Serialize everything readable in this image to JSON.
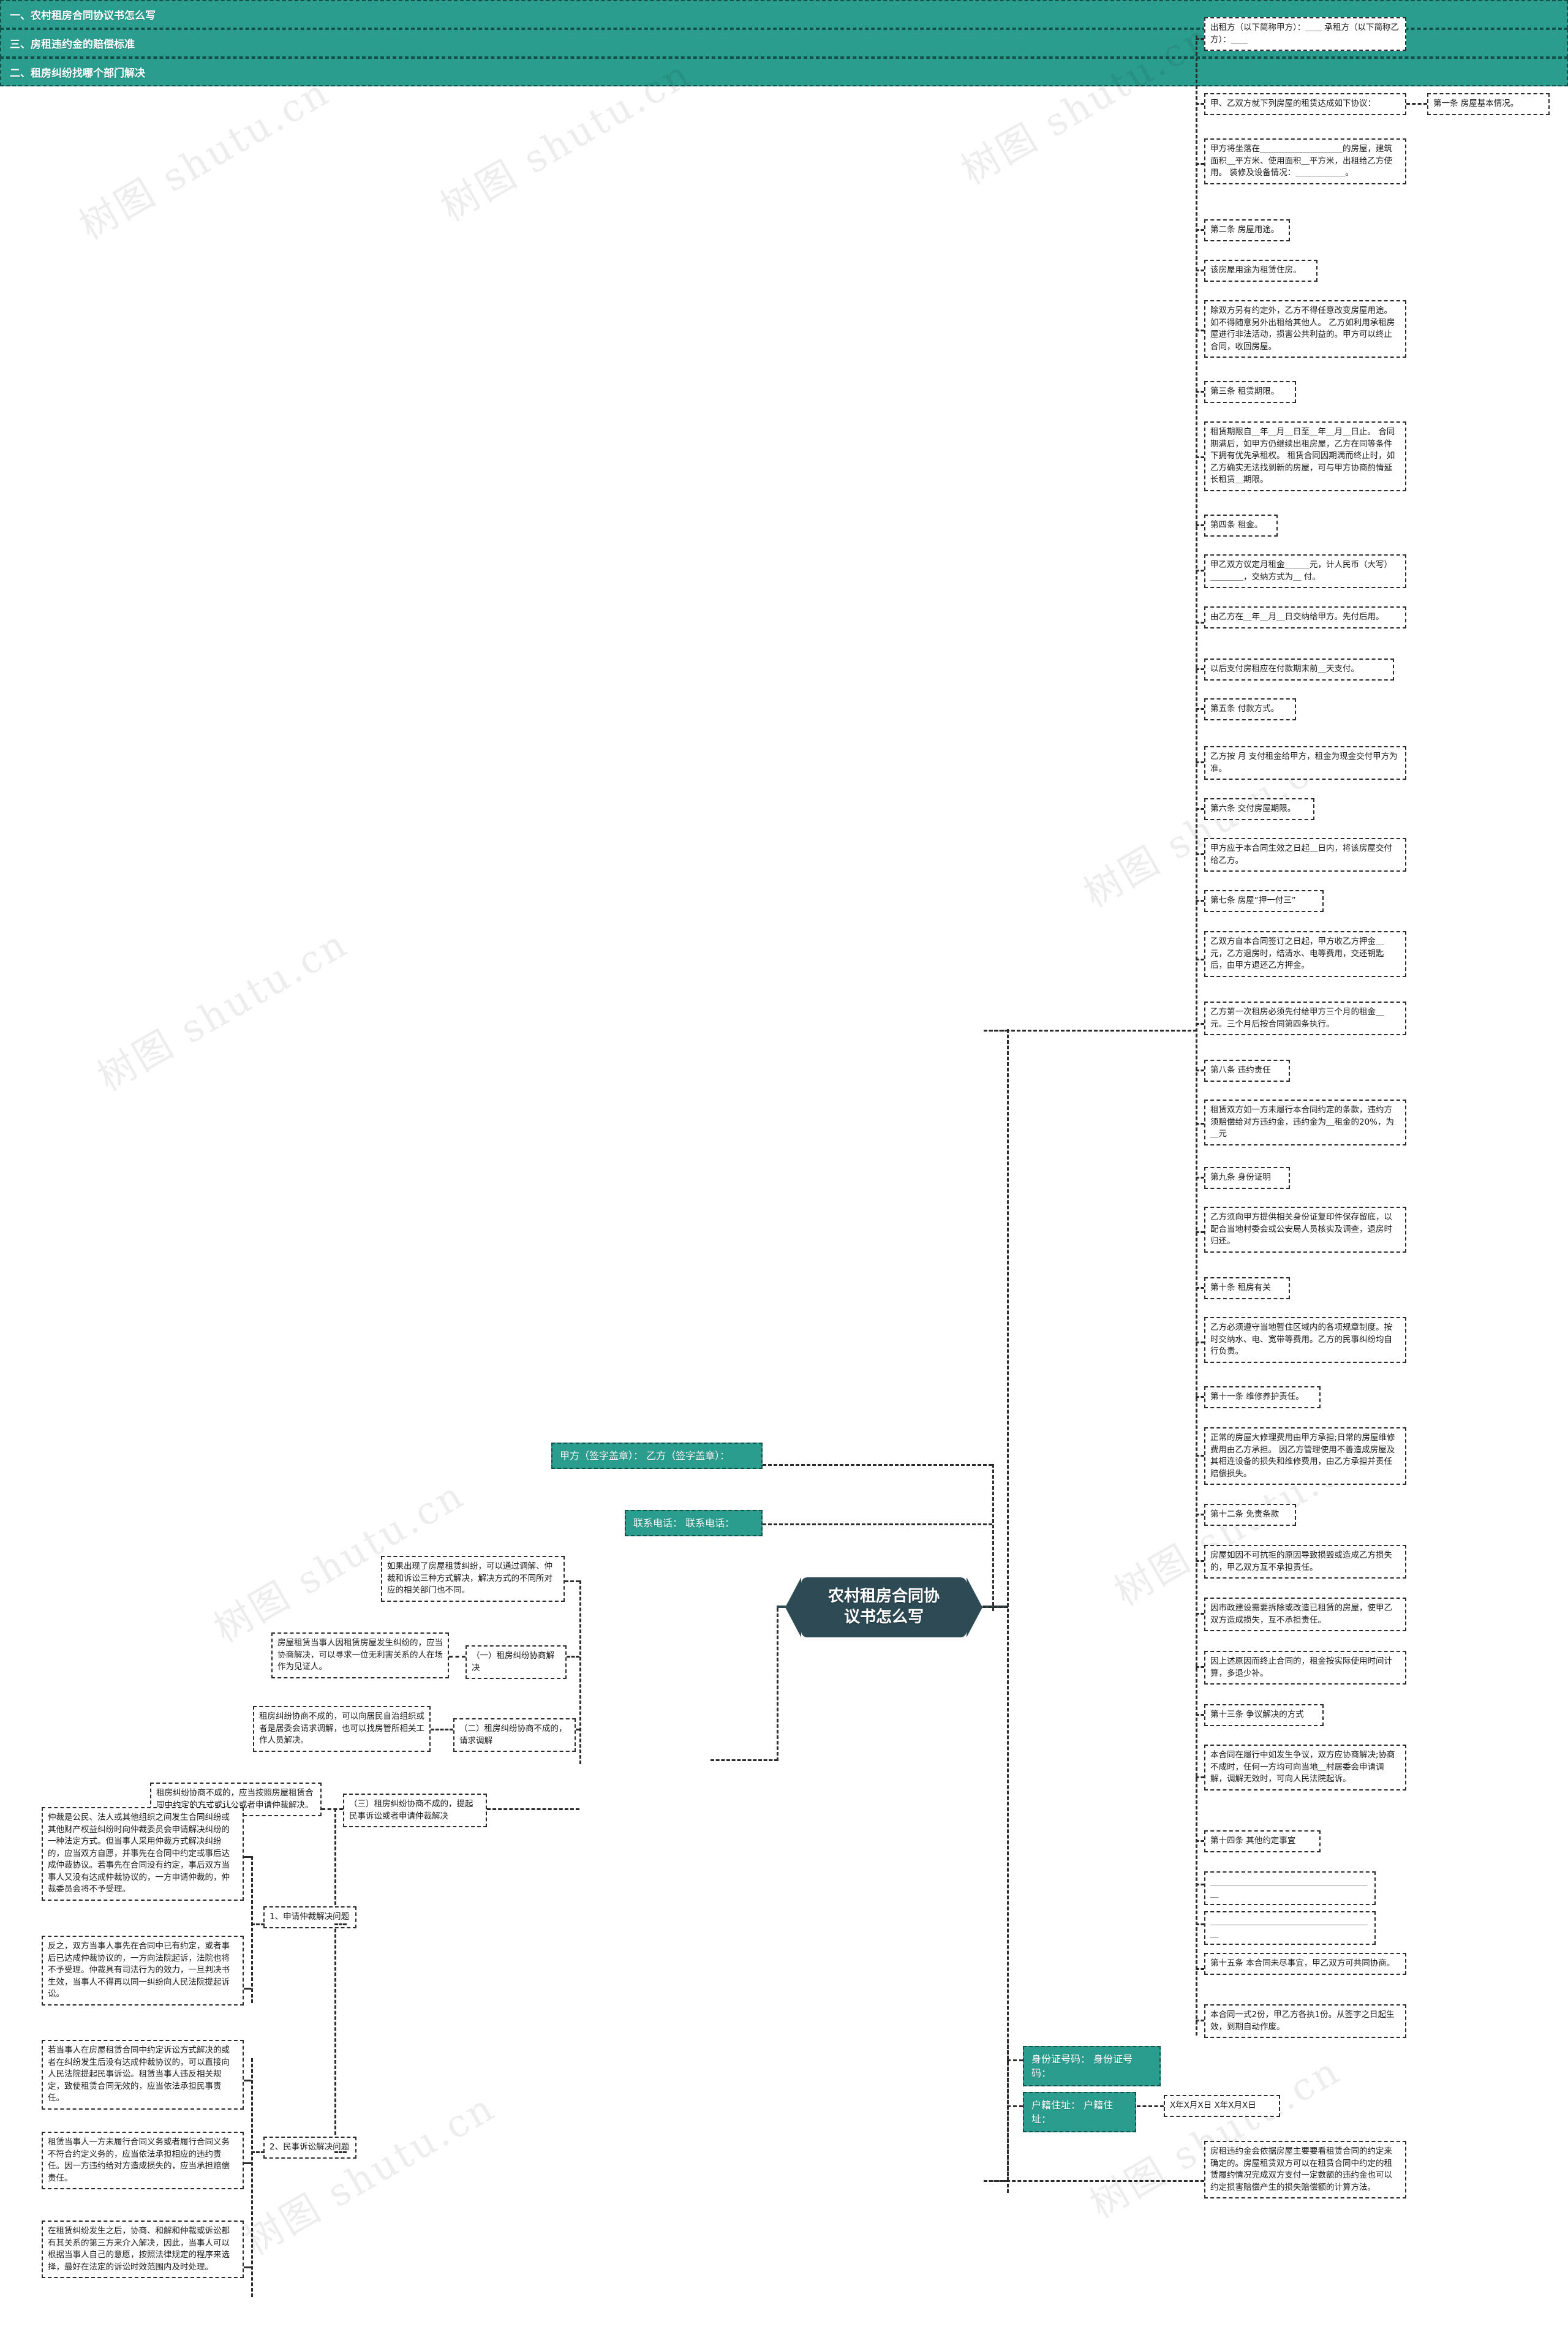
{
  "root": {
    "title": "农村租房合同协议书怎么写"
  },
  "watermarks": [
    "树图 shutu.cn",
    "树图 shutu.cn",
    "树图 shutu.cn",
    "树图 shutu.cn",
    "树图 shutu.cn",
    "树图 shutu.cn",
    "树图 shutu.cn",
    "树图 shutu.cn",
    "树图 shutu.cn"
  ],
  "branches": [
    {
      "id": "b1",
      "label": "一、农村租房合同协议书怎么写"
    },
    {
      "id": "b2",
      "label": "二、租房纠纷找哪个部门解决"
    },
    {
      "id": "b3",
      "label": "三、房租违约金的赔偿标准"
    }
  ],
  "branch1_nodes": [
    "出租方（以下简称甲方）：＿＿ 承租方（以下简称乙方）：＿＿",
    "甲、乙双方就下列房屋的租赁达成如下协议：",
    "第一条 房屋基本情况。",
    "甲方将坐落在＿＿＿＿＿＿＿＿＿＿的房屋，建筑面积＿平方米、使用面积＿平方米，出租给乙方使用。 装修及设备情况：＿＿＿＿＿＿。",
    "第二条 房屋用途。",
    "该房屋用途为租赁住房。",
    "除双方另有约定外，乙方不得任意改变房屋用途。如不得随意另外出租给其他人。 乙方如利用承租房屋进行非法活动，损害公共利益的。甲方可以终止合同，收回房屋。",
    "第三条 租赁期限。",
    "租赁期限自＿年＿月＿日至＿年＿月＿日止。 合同期满后，如甲方仍继续出租房屋，乙方在同等条件下拥有优先承租权。 租赁合同因期满而终止时，如乙方确实无法找到新的房屋，可与甲方协商酌情延长租赁＿期限。",
    "第四条 租金。",
    "甲乙双方议定月租金＿＿＿元，计人民币（大写）＿＿＿＿，交纳方式为＿ 付。",
    "由乙方在＿年＿月＿日交纳给甲方。先付后用。",
    "以后支付房租应在付款期末前＿天支付。",
    "第五条 付款方式。",
    "乙方按 月 支付租金给甲方，租金为现金交付甲方为准。",
    "第六条 交付房屋期限。",
    "甲方应于本合同生效之日起＿日内，将该房屋交付给乙方。",
    "第七条 房屋“押一付三”",
    "乙双方自本合同签订之日起，甲方收乙方押金＿元，乙方退房时，结清水、电等费用，交还钥匙后，由甲方退还乙方押金。",
    "乙方第一次租房必须先付给甲方三个月的租金＿元。三个月后按合同第四条执行。",
    "第八条 违约责任",
    "租赁双方如一方未履行本合同约定的条款，违约方须赔偿给对方违约金，违约金为＿租金的20%，为＿元",
    "第九条 身份证明",
    "乙方须向甲方提供相关身份证复印件保存留底，以配合当地村委会或公安局人员核实及调查，退房时归还。",
    "第十条 租房有关",
    "乙方必须遵守当地暂住区域内的各项规章制度。按时交纳水、电、宽带等费用。乙方的民事纠纷均自行负责。",
    "第十一条 维修养护责任。",
    "正常的房屋大修理费用由甲方承担;日常的房屋维修费用由乙方承担。 因乙方管理使用不善造成房屋及其相连设备的损失和维修费用，由乙方承担并责任赔偿损失。",
    "第十二条 免责条款",
    "房屋如因不可抗拒的原因导致损毁或造成乙方损失的，甲乙双方互不承担责任。",
    "因市政建设需要拆除或改造已租赁的房屋，使甲乙双方造成损失，互不承担责任。",
    "因上述原因而终止合同的，租金按实际使用时间计算，多退少补。",
    "第十三条 争议解决的方式",
    "本合同在履行中如发生争议，双方应协商解决;协商不成时，任何一方均可向当地＿村居委会申请调解，调解无效时，可向人民法院起诉。",
    "第十四条 其他约定事宜",
    "＿＿＿＿＿＿＿＿＿＿＿＿＿＿＿＿＿＿＿＿",
    "＿＿＿＿＿＿＿＿＿＿＿＿＿＿＿＿＿＿＿＿",
    "第十五条 本合同未尽事宜，甲乙双方可共同协商。",
    "本合同一式2份，甲乙方各执1份。从签字之日起生效，到期自动作废。"
  ],
  "signature_nodes": [
    "甲方（签字盖章）： 乙方（签字盖章）：",
    "联系电话： 联系电话："
  ],
  "footer_nodes": [
    "身份证号码： 身份证号码：",
    "户籍住址： 户籍住址：",
    "X年X月X日 X年X月X日"
  ],
  "branch2": {
    "intro": "如果出现了房屋租赁纠纷，可以通过调解、仲裁和诉讼三种方式解决，解决方式的不同所对应的相关部门也不同。",
    "subs": [
      {
        "label": "（一）租房纠纷协商解决",
        "details": [
          "房屋租赁当事人因租赁房屋发生纠纷的，应当协商解决，可以寻求一位无利害关系的人在场作为见证人。"
        ]
      },
      {
        "label": "（二）租房纠纷协商不成的，请求调解",
        "details": [
          "租房纠纷协商不成的，可以向居民自治组织或者是居委会请求调解，也可以找房管所相关工作人员解决。"
        ]
      },
      {
        "label": "（三）租房纠纷协商不成的，提起民事诉讼或者申请仲裁解决",
        "details": [
          "租房纠纷协商不成的，应当按照房屋租赁合同中约定的方式或认公或者申请仲裁解决。"
        ],
        "children": [
          {
            "label": "1、申请仲裁解决问题",
            "details": [
              "仲裁是公民、法人或其他组织之间发生合同纠纷或其他财产权益纠纷时向仲裁委员会申请解决纠纷的一种法定方式。但当事人采用仲裁方式解决纠纷的，应当双方自愿，并事先在合同中约定或事后达成仲裁协议。若事先在合同没有约定，事后双方当事人又没有达成仲裁协议的，一方申请仲裁的，仲裁委员会将不予受理。",
              "反之，双方当事人事先在合同中已有约定，或者事后已达成仲裁协议的，一方向法院起诉，法院也将不予受理。仲裁具有司法行为的效力，一旦判决书生效，当事人不得再以同一纠纷向人民法院提起诉讼。"
            ]
          },
          {
            "label": "2、民事诉讼解决问题",
            "details": [
              "若当事人在房屋租赁合同中约定诉讼方式解决的或者在纠纷发生后没有达成仲裁协议的，可以直接向人民法院提起民事诉讼。租赁当事人违反相关规定，致使租赁合同无效的，应当依法承担民事责任。",
              "租赁当事人一方未履行合同义务或者履行合同义务不符合约定义务的，应当依法承担相应的违约责任。因一方违约给对方造成损失的，应当承担赔偿责任。",
              "在租赁纠纷发生之后，协商、和解和仲裁或诉讼都有其关系的第三方来介入解决，因此，当事人可以根据当事人自己的意愿，按照法律规定的程序来选择，最好在法定的诉讼时效范围内及时处理。"
            ]
          }
        ]
      }
    ]
  },
  "branch3": {
    "detail": "房租违约金会依据房屋主要要看租赁合同的约定来确定的。房屋租赁双方可以在租赁合同中约定的租赁履约情况完成双方支付一定数额的违约金也可以约定损害赔偿产生的损失赔偿额的计算方法。"
  }
}
